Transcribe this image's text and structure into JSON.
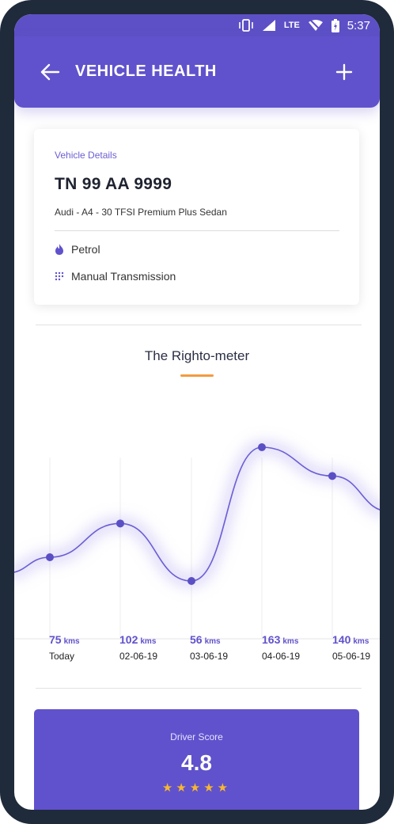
{
  "status_bar": {
    "time": "5:37",
    "network": "LTE"
  },
  "app_bar": {
    "title": "VEHICLE HEALTH"
  },
  "vehicle": {
    "section_label": "Vehicle Details",
    "plate": "TN 99 AA 9999",
    "model": "Audi - A4 - 30 TFSI Premium Plus Sedan",
    "fuel": "Petrol",
    "transmission": "Manual Transmission"
  },
  "meter": {
    "title": "The Righto-meter"
  },
  "chart_data": {
    "type": "line",
    "categories": [
      "Today",
      "02-06-19",
      "03-06-19",
      "04-06-19",
      "05-06-19"
    ],
    "values": [
      75,
      102,
      56,
      163,
      140
    ],
    "unit": "kms"
  },
  "days": [
    {
      "value": "75",
      "unit": "kms",
      "date": "Today"
    },
    {
      "value": "102",
      "unit": "kms",
      "date": "02-06-19"
    },
    {
      "value": "56",
      "unit": "kms",
      "date": "03-06-19"
    },
    {
      "value": "163",
      "unit": "kms",
      "date": "04-06-19"
    },
    {
      "value": "140",
      "unit": "kms",
      "date": "05-06-19"
    }
  ],
  "driver_score": {
    "label": "Driver Score",
    "value": "4.8",
    "rating": 4.5,
    "stars": "★★★★★"
  },
  "colors": {
    "primary": "#6052cc",
    "accent": "#f39b40",
    "star": "#f7b731"
  }
}
